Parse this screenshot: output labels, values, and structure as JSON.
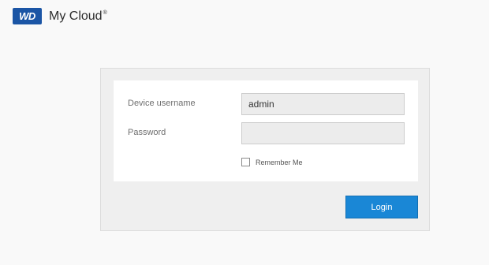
{
  "header": {
    "logo_text": "WD",
    "product_name": "My Cloud",
    "trademark": "®",
    "brand_color": "#1b55a5"
  },
  "login_form": {
    "username_label": "Device username",
    "username_value": "admin",
    "password_label": "Password",
    "password_value": "",
    "remember_label": "Remember Me",
    "remember_checked": false,
    "login_button_label": "Login",
    "button_color": "#1a87d6"
  }
}
